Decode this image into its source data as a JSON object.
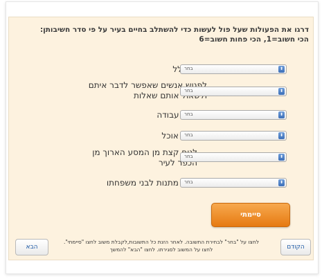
{
  "question": "דרגו את הפעולות שעל פול לעשות כדי להשתלב בחיים בעיר על פי סדר חשיבותן: הכי חשוב=1, הכי פחות חשוב=6",
  "select_placeholder": "בחר",
  "items": [
    {
      "label": "להתפלל"
    },
    {
      "label": "לפגוש אנשים שאפשר לדבר איתם ולשאול אותם שאלות"
    },
    {
      "label": "לחפש עבודה"
    },
    {
      "label": "לקנות אוכל"
    },
    {
      "label": "לנוח קצת מן המסע הארוך מן הכפר לעיר"
    },
    {
      "label": "לקנות מתנות לבני משפחתו"
    }
  ],
  "done_button": "סיימתי",
  "instructions": "לחצו על \"בחר\" לבחירת התשובה. לאחר הזנת כל התשובות,לקבלת משוב לחצו \"סיימתי\". לחצו על המשוב לסגירתו. לחצו \"הבא\" להמשך",
  "nav": {
    "prev": "הקודם",
    "next": "הבא"
  },
  "colors": {
    "panel_bg": "#fdf2df",
    "done_button": "#f08c24",
    "nav_text": "#1e5aa6"
  }
}
